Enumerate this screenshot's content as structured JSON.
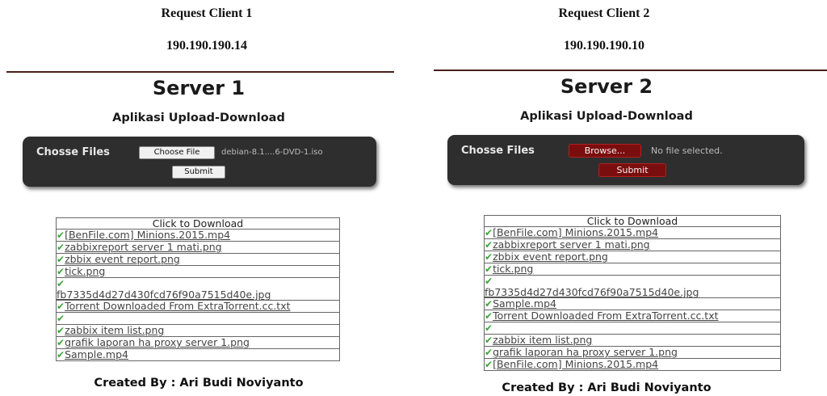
{
  "left": {
    "client_title": "Request Client 1",
    "client_ip": "190.190.190.14",
    "server_title": "Server 1",
    "app_title": "Aplikasi Upload-Download",
    "upload": {
      "label": "Chosse Files",
      "choose_button": "Choose File",
      "file_status": "debian-8.1....6-DVD-1.iso",
      "submit_button": "Submit"
    },
    "table_header": "Click to Download",
    "files": [
      "[BenFile.com] Minions.2015.mp4",
      "zabbixreport server 1 mati.png",
      "zbbix event report.png",
      "tick.png",
      "fb7335d4d27d430fcd76f90a7515d40e.jpg",
      "Torrent Downloaded From ExtraTorrent.cc.txt",
      "",
      "zabbix item list.png",
      "grafik laporan ha proxy server 1.png",
      "Sample.mp4"
    ],
    "footer": "Created By : Ari Budi Noviyanto"
  },
  "right": {
    "client_title": "Request Client 2",
    "client_ip": "190.190.190.10",
    "server_title": "Server 2",
    "app_title": "Aplikasi Upload-Download",
    "upload": {
      "label": "Chosse Files",
      "choose_button": "Browse...",
      "file_status": "No file selected.",
      "submit_button": "Submit"
    },
    "table_header": "Click to Download",
    "files": [
      "[BenFile.com] Minions.2015.mp4",
      "zabbixreport server 1 mati.png",
      "zbbix event report.png",
      "tick.png",
      "fb7335d4d27d430fcd76f90a7515d40e.jpg",
      "Sample.mp4",
      "Torrent Downloaded From ExtraTorrent.cc.txt",
      "",
      "zabbix item list.png",
      "grafik laporan ha proxy server 1.png",
      "[BenFile.com] Minions.2015.mp4"
    ],
    "footer": "Created By : Ari Budi Noviyanto"
  },
  "colors": {
    "panel": "#2e2e2e",
    "divider": "#4a1f1a",
    "check": "#3aa537",
    "browse_red": "#7a0e0e"
  }
}
